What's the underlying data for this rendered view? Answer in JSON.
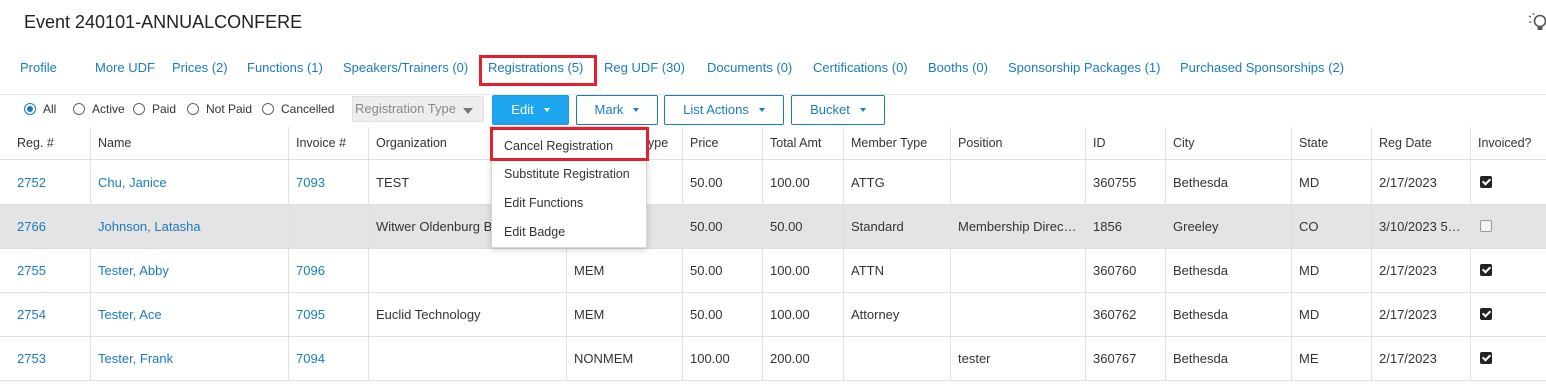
{
  "page": {
    "title": "Event 240101-ANNUALCONFERE"
  },
  "icons": {
    "header_right": "lightbulb-icon"
  },
  "colors": {
    "link": "#1a7bbf",
    "primary_button": "#1ea5f0",
    "highlight": "#e3202d",
    "selected_row": "#e4e4e4"
  },
  "tabs": [
    {
      "label": "Profile"
    },
    {
      "label": "More UDF"
    },
    {
      "label": "Prices (2)"
    },
    {
      "label": "Functions (1)"
    },
    {
      "label": "Speakers/Trainers (0)"
    },
    {
      "label": "Registrations (5)",
      "active": true
    },
    {
      "label": "Reg UDF (30)"
    },
    {
      "label": "Documents (0)"
    },
    {
      "label": "Certifications (0)"
    },
    {
      "label": "Booths (0)"
    },
    {
      "label": "Sponsorship Packages (1)"
    },
    {
      "label": "Purchased Sponsorships (2)"
    }
  ],
  "filters": {
    "options": [
      "All",
      "Active",
      "Paid",
      "Not Paid",
      "Cancelled"
    ],
    "selected": "All"
  },
  "registration_type": {
    "placeholder": "Registration Type"
  },
  "buttons": {
    "edit": "Edit",
    "mark": "Mark",
    "list_actions": "List Actions",
    "bucket": "Bucket"
  },
  "edit_menu": {
    "items": [
      "Cancel Registration",
      "Substitute Registration",
      "Edit Functions",
      "Edit Badge"
    ],
    "highlighted": "Cancel Registration"
  },
  "table": {
    "columns": [
      "Reg. #",
      "Name",
      "Invoice #",
      "Organization",
      "ype",
      "Price",
      "Total Amt",
      "Member Type",
      "Position",
      "ID",
      "City",
      "State",
      "Reg Date",
      "Invoiced?"
    ],
    "rows": [
      {
        "reg": "2752",
        "name": "Chu, Janice",
        "invoice": "7093",
        "org": "TEST",
        "type": "",
        "price": "50.00",
        "total": "100.00",
        "member_type": "ATTG",
        "position": "",
        "id": "360755",
        "city": "Bethesda",
        "state": "MD",
        "reg_date": "2/17/2023",
        "invoiced": true
      },
      {
        "reg": "2766",
        "name": "Johnson, Latasha",
        "invoice": "",
        "org": "Witwer Oldenburg B",
        "type": "",
        "price": "50.00",
        "total": "50.00",
        "member_type": "Standard",
        "position": "Membership Direc…",
        "id": "1856",
        "city": "Greeley",
        "state": "CO",
        "reg_date": "3/10/2023 5…",
        "invoiced": false,
        "selected": true
      },
      {
        "reg": "2755",
        "name": "Tester, Abby",
        "invoice": "7096",
        "org": "",
        "type": "MEM",
        "price": "50.00",
        "total": "100.00",
        "member_type": "ATTN",
        "position": "",
        "id": "360760",
        "city": "Bethesda",
        "state": "MD",
        "reg_date": "2/17/2023",
        "invoiced": true
      },
      {
        "reg": "2754",
        "name": "Tester, Ace",
        "invoice": "7095",
        "org": "Euclid Technology",
        "type": "MEM",
        "price": "50.00",
        "total": "100.00",
        "member_type": "Attorney",
        "position": "",
        "id": "360762",
        "city": "Bethesda",
        "state": "MD",
        "reg_date": "2/17/2023",
        "invoiced": true
      },
      {
        "reg": "2753",
        "name": "Tester, Frank",
        "invoice": "7094",
        "org": "",
        "type": "NONMEM",
        "price": "100.00",
        "total": "200.00",
        "member_type": "",
        "position": "tester",
        "id": "360767",
        "city": "Bethesda",
        "state": "ME",
        "reg_date": "2/17/2023",
        "invoiced": true
      }
    ]
  }
}
